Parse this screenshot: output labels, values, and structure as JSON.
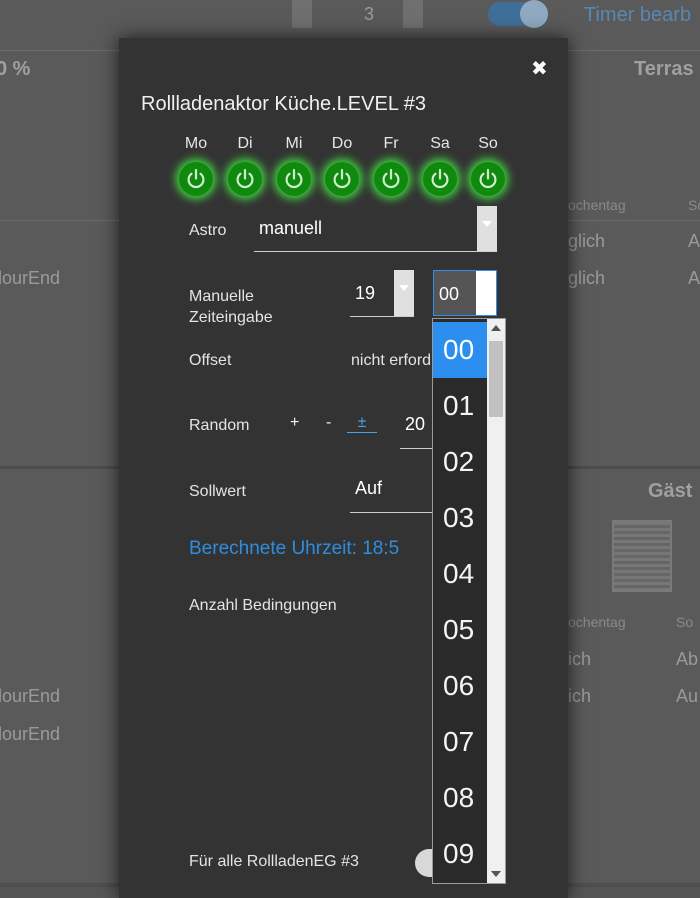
{
  "background": {
    "spinner_value": "3",
    "timer_label": "Timer bearb",
    "pct": "0 %",
    "terrace": "Terras",
    "gaeste": "Gäst",
    "wochentag": "ochentag",
    "so_col": "So",
    "taeglich": "glich",
    "a_col": "A",
    "hourend": "lourEnd",
    "ich": "ich",
    "ab": "Ab",
    "au": "Au"
  },
  "dialog": {
    "close_glyph": "✖",
    "title": "Rollladenaktor Küche.LEVEL #3",
    "days": [
      "Mo",
      "Di",
      "Mi",
      "Do",
      "Fr",
      "Sa",
      "So"
    ],
    "astro_label": "Astro",
    "astro_value": "manuell",
    "manual_label": "Manuelle Zeiteingabe",
    "hour_value": "19",
    "minute_value": "00",
    "offset_label": "Offset",
    "offset_value": "nicht erforde",
    "random_label": "Random",
    "random_plus": "+",
    "random_minus": "-",
    "random_pm": "±",
    "random_value": "20",
    "sollwert_label": "Sollwert",
    "sollwert_value": "Auf",
    "calc_time": "Berechnete Uhrzeit: 18:5",
    "conditions_label": "Anzahl Bedingungen",
    "apply_all_label": "Für alle RollladenEG #3"
  },
  "dropdown": {
    "options": [
      "00",
      "01",
      "02",
      "03",
      "04",
      "05",
      "06",
      "07",
      "08",
      "09"
    ],
    "selected": "00"
  },
  "colors": {
    "accent": "#2c8ff0",
    "power_on": "#0f8a0f",
    "dialog_bg": "#333333"
  }
}
